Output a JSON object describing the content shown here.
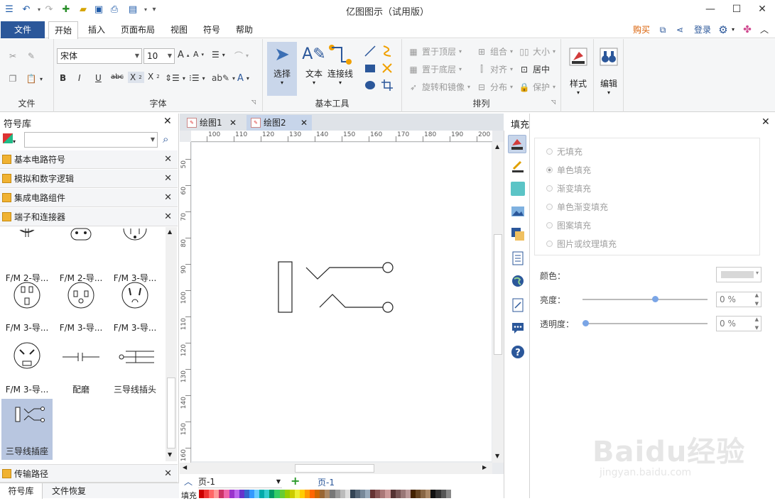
{
  "app": {
    "title": "亿图图示（试用版）",
    "window_controls": {
      "minimize": "—",
      "maximize": "☐",
      "close": "✕"
    }
  },
  "menu": {
    "file": "文件",
    "tabs": [
      "开始",
      "插入",
      "页面布局",
      "视图",
      "符号",
      "帮助"
    ],
    "right": {
      "buy": "购买",
      "login": "登录"
    }
  },
  "ribbon": {
    "groups": {
      "file": "文件",
      "font": "字体",
      "tools": "基本工具",
      "arrange": "排列"
    },
    "font": {
      "name": "宋体",
      "size": "10"
    },
    "select": "选择",
    "text": "文本",
    "connector": "连接线",
    "arrange": {
      "bring_front": "置于顶层",
      "send_back": "置于底层",
      "rotate_mirror": "旋转和镜像",
      "group": "组合",
      "align": "对齐",
      "distribute": "分布",
      "size": "大小",
      "center": "居中",
      "protect": "保护"
    },
    "style": "样式",
    "edit": "编辑"
  },
  "left_panel": {
    "title": "符号库",
    "search_placeholder": "",
    "libraries": [
      "基本电路符号",
      "模拟和数字逻辑",
      "集成电路组件",
      "端子和连接器"
    ],
    "symbol_labels": [
      "F/M 2-导...",
      "F/M 2-导...",
      "F/M 3-导...",
      "F/M 3-导...",
      "F/M 3-导...",
      "F/M 3-导...",
      "F/M 3-导...",
      "配磨",
      "三导线插头",
      "三导线插座"
    ],
    "bottom_library": "传输路径",
    "bottom_tabs": [
      "符号库",
      "文件恢复"
    ]
  },
  "documents": {
    "tabs": [
      "绘图1",
      "绘图2"
    ],
    "active": "绘图2"
  },
  "rulers": {
    "horizontal": [
      "100",
      "110",
      "120",
      "130",
      "140",
      "150",
      "160",
      "170",
      "180",
      "190",
      "200"
    ],
    "vertical": [
      "50",
      "60",
      "70",
      "80",
      "90",
      "100",
      "110",
      "120",
      "130",
      "140",
      "150",
      "160"
    ]
  },
  "page_bar": {
    "page_select": "页-1",
    "page_tab": "页-1",
    "fill_label": "填充"
  },
  "fill_panel": {
    "title": "填充",
    "options": [
      "无填充",
      "单色填充",
      "渐变填充",
      "单色渐变填充",
      "图案填充",
      "图片或纹理填充"
    ],
    "selected": "单色填充",
    "color_label": "颜色：",
    "brightness_label": "亮度：",
    "brightness_value": "0 %",
    "brightness_level": 0.58,
    "transparency_label": "透明度：",
    "transparency_value": "0 %",
    "transparency_level": 0.0
  },
  "watermark": {
    "text": "Baidu经验",
    "url_text": "jingyan.baidu.com"
  },
  "colors": {
    "accent": "#2b579a",
    "selected_tile": "#b8c6e0",
    "buy": "#d95d00"
  }
}
